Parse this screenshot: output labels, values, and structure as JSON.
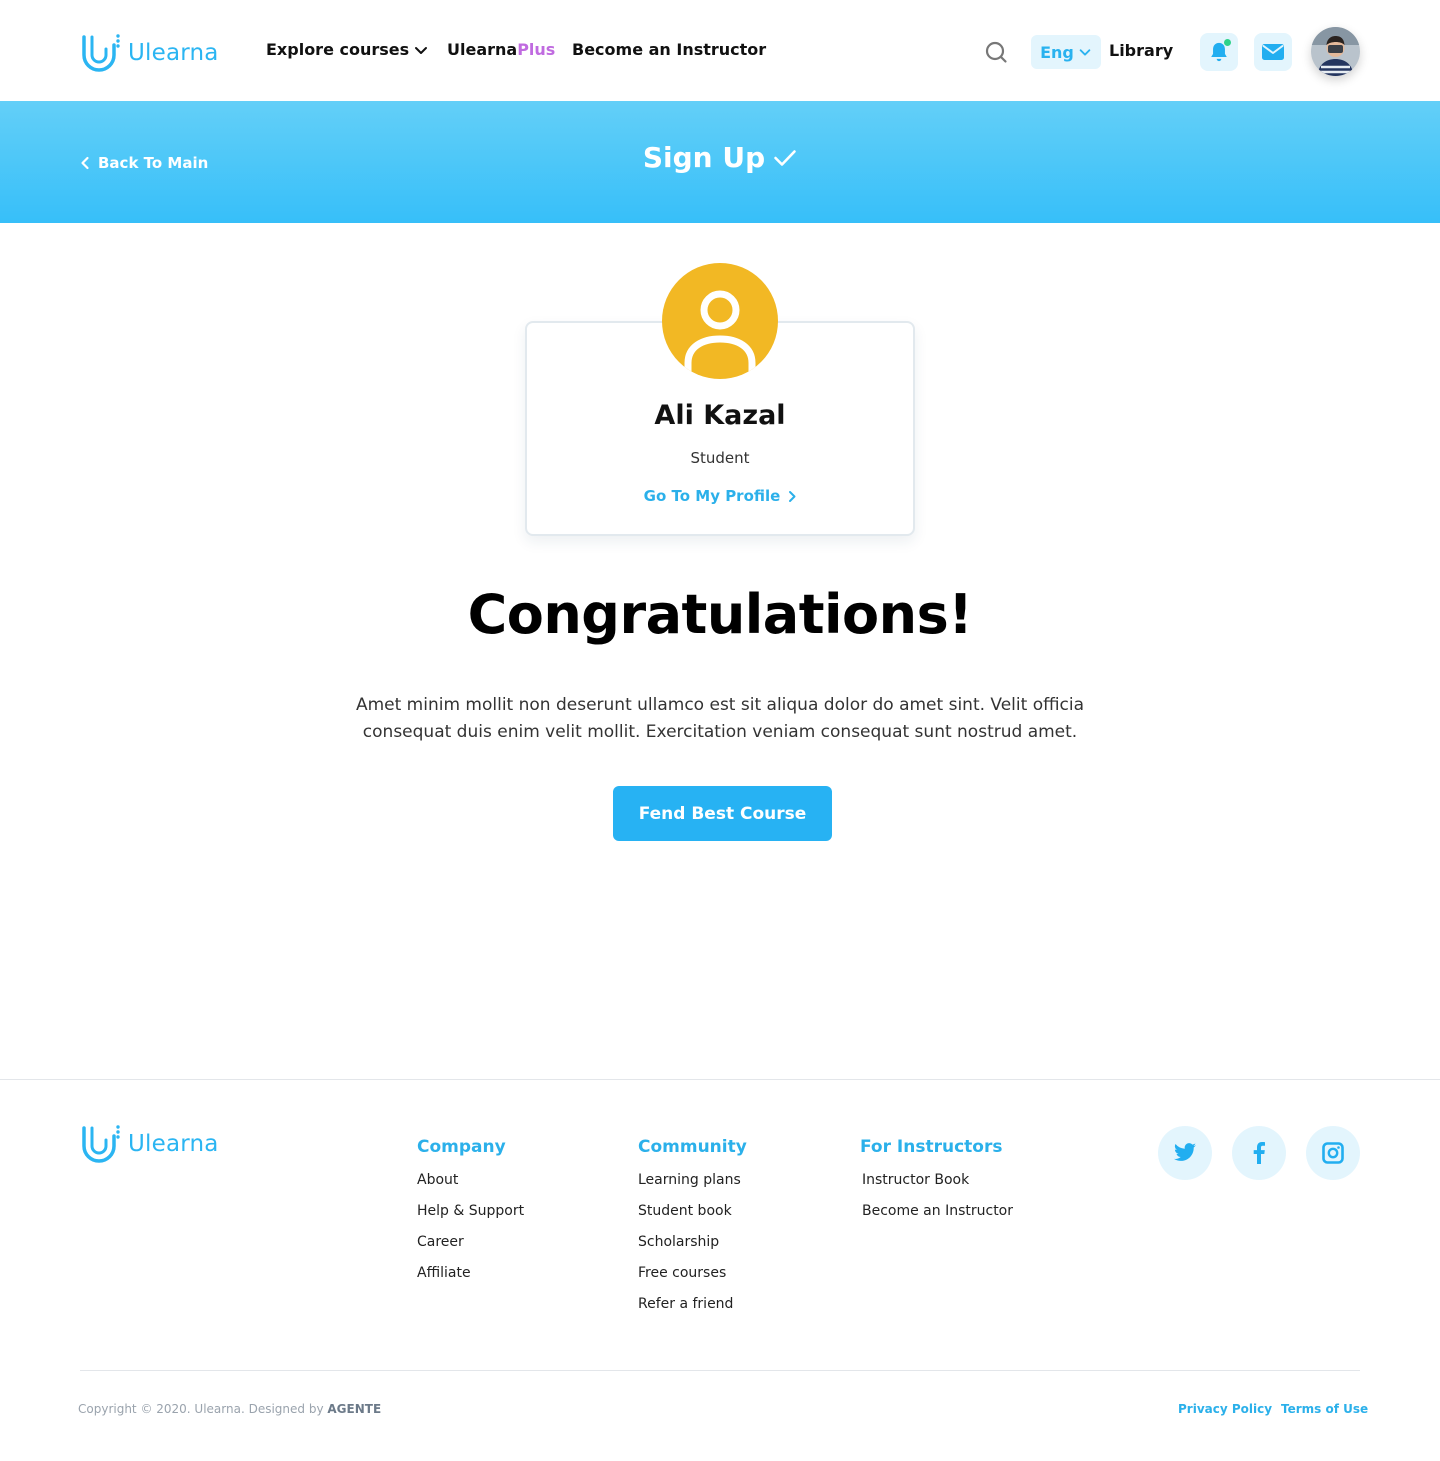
{
  "brand": {
    "name": "Ulearna",
    "color": "#2bb5f2"
  },
  "header": {
    "nav": {
      "explore": "Explore courses",
      "plus_prefix": "Ulearna",
      "plus_suffix": "Plus",
      "instructor": "Become an Instructor"
    },
    "language": "Eng",
    "library": "Library",
    "icons": [
      "search-icon",
      "bell-icon",
      "mail-icon",
      "avatar"
    ]
  },
  "banner": {
    "back": "Back To Main",
    "title": "Sign Up"
  },
  "card": {
    "name": "Ali Kazal",
    "role": "Student",
    "link": "Go To My Profile"
  },
  "main": {
    "heading": "Congratulations!",
    "paragraph": "Amet minim mollit non deserunt ullamco est sit aliqua dolor do amet sint. Velit officia consequat duis enim velit mollit. Exercitation veniam consequat sunt nostrud amet.",
    "cta": "Fend Best Course"
  },
  "footer": {
    "columns": [
      {
        "title": "Company",
        "links": [
          "About",
          "Help & Support",
          "Career",
          "Affiliate"
        ]
      },
      {
        "title": "Community",
        "links": [
          "Learning plans",
          "Student book",
          "Scholarship",
          "Free courses",
          "Refer a friend"
        ]
      },
      {
        "title": "For Instructors",
        "links": [
          "Instructor Book",
          "Become an Instructor"
        ]
      }
    ],
    "social": [
      "twitter-icon",
      "facebook-icon",
      "instagram-icon"
    ],
    "copyright": "Copyright © 2020. Ulearna. Designed by",
    "designer": "AGENTE",
    "privacy": "Privacy Policy",
    "terms": "Terms of Use"
  }
}
